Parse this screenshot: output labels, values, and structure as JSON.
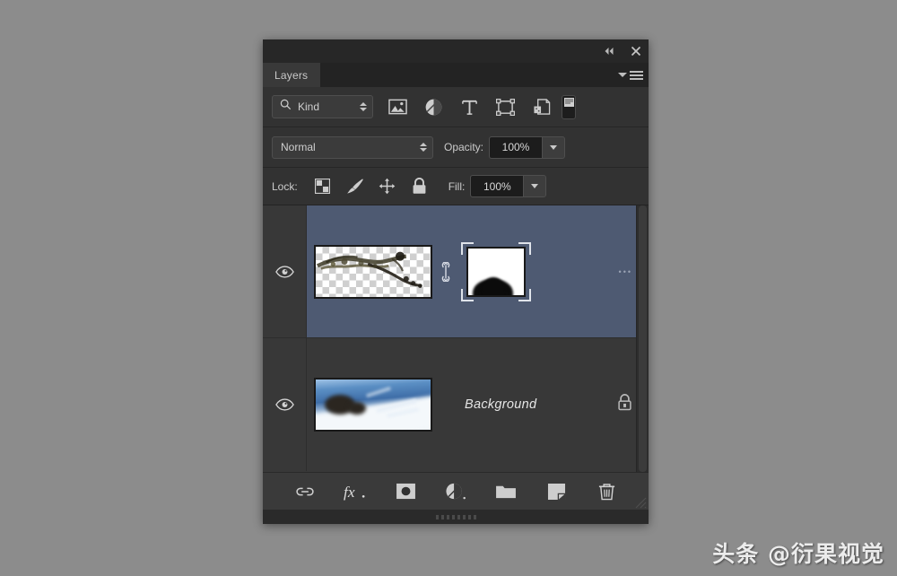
{
  "app": {
    "panel_title": "Layers",
    "window_controls": {
      "collapse": "collapse-to-icons",
      "close": "close"
    },
    "panel_menu": "panel-menu"
  },
  "filter_bar": {
    "kind_label": "Kind",
    "search_icon": "search-icon",
    "icons": [
      {
        "name": "filter-pixel-icon",
        "title": "Pixel layers"
      },
      {
        "name": "filter-adjustment-icon",
        "title": "Adjustment layers"
      },
      {
        "name": "filter-type-icon",
        "title": "Type layers"
      },
      {
        "name": "filter-shape-icon",
        "title": "Shape layers"
      },
      {
        "name": "filter-smart-object-icon",
        "title": "Smart objects"
      }
    ],
    "toggle_name": "filter-enable-toggle"
  },
  "blend_bar": {
    "blend_mode": "Normal",
    "opacity_label": "Opacity:",
    "opacity_value": "100%"
  },
  "lock_bar": {
    "lock_label": "Lock:",
    "icons": [
      {
        "name": "lock-transparent-pixels-icon"
      },
      {
        "name": "lock-image-pixels-icon"
      },
      {
        "name": "lock-position-icon"
      },
      {
        "name": "lock-all-icon"
      }
    ],
    "fill_label": "Fill:",
    "fill_value": "100%"
  },
  "layers": [
    {
      "name": "",
      "selected": true,
      "visible": true,
      "thumbnail": "transparent-branch-thumbnail",
      "has_link": true,
      "mask": "layer-mask-white-with-black-strokes",
      "mask_selected": true,
      "overflow": "•••",
      "locked": false
    },
    {
      "name": "Background",
      "selected": false,
      "visible": true,
      "thumbnail": "snow-mountain-thumbnail",
      "has_link": false,
      "mask": null,
      "mask_selected": false,
      "overflow": "",
      "locked": true
    }
  ],
  "bottom_toolbar": [
    {
      "name": "link-layers-icon",
      "label": "Link layers"
    },
    {
      "name": "layer-style-fx-icon",
      "label": "fx"
    },
    {
      "name": "add-layer-mask-icon",
      "label": "Add layer mask"
    },
    {
      "name": "new-adjustment-layer-icon",
      "label": "New adjustment layer"
    },
    {
      "name": "new-group-icon",
      "label": "New group"
    },
    {
      "name": "new-layer-icon",
      "label": "New layer"
    },
    {
      "name": "delete-layer-icon",
      "label": "Delete layer"
    }
  ],
  "watermark": {
    "text": "头条 @衍果视觉"
  },
  "colors": {
    "panel_bg": "#323232",
    "list_bg": "#383838",
    "selected_row": "#4e5a72",
    "text": "#cfcfcf",
    "desktop": "#8c8c8c"
  }
}
